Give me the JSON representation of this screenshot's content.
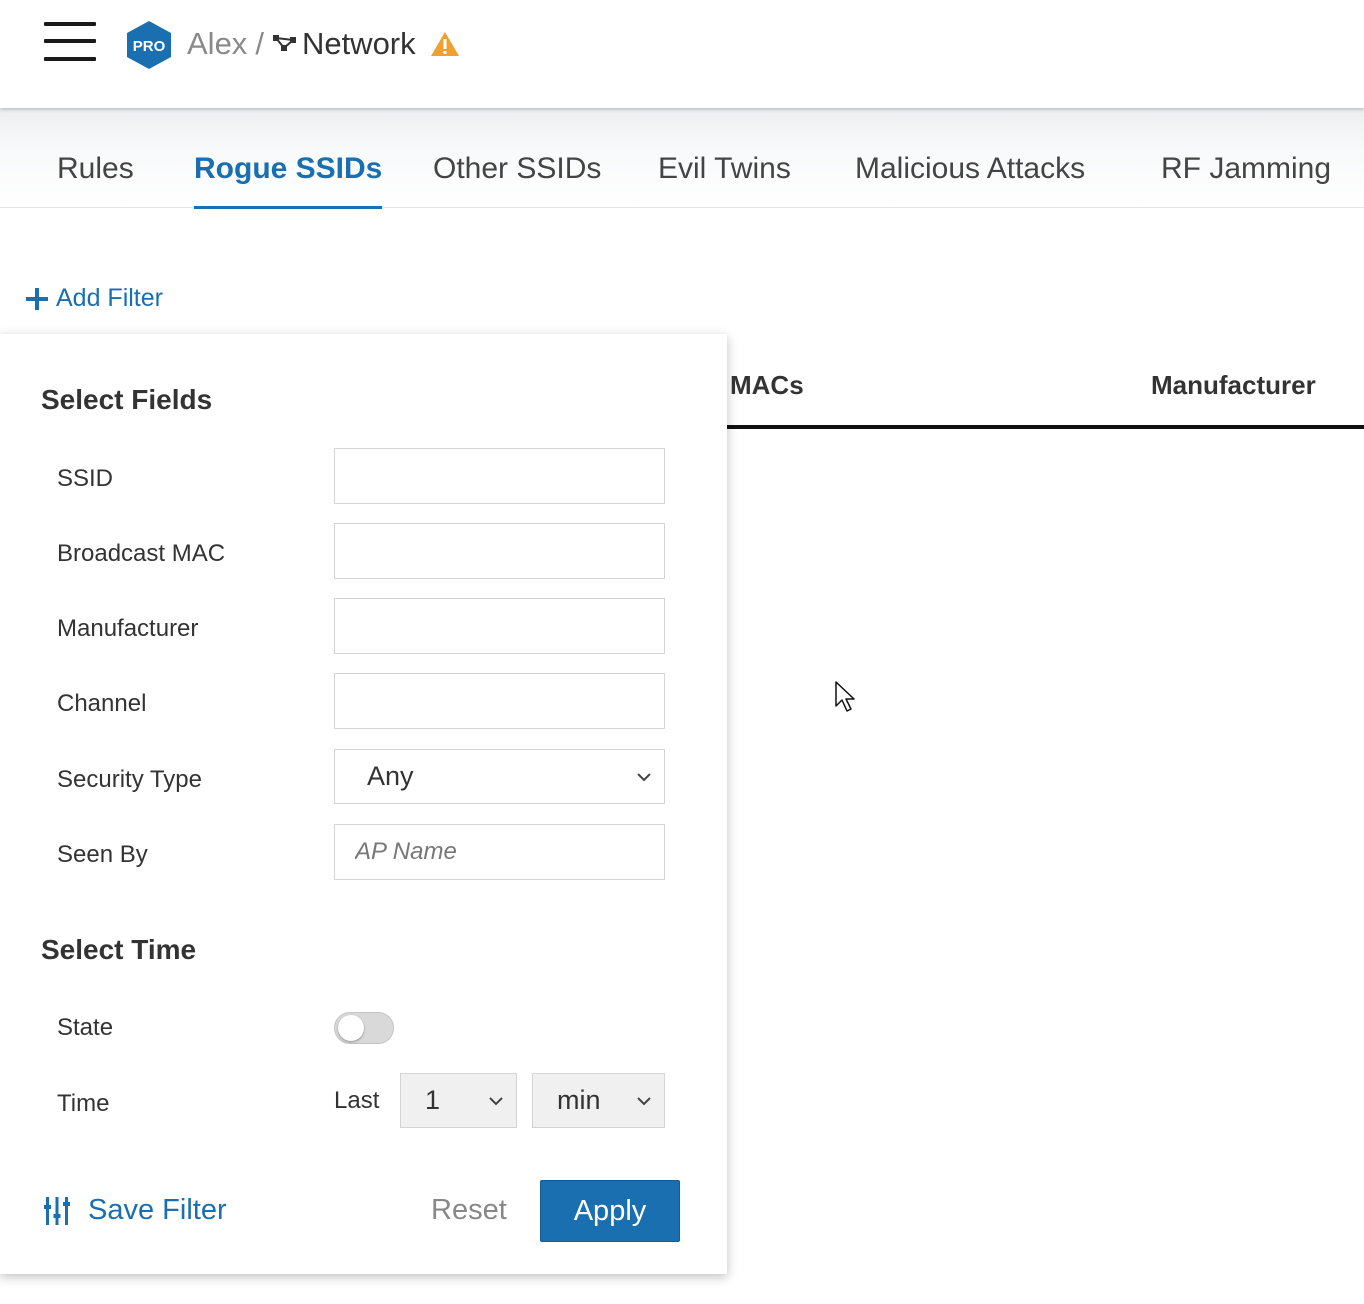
{
  "header": {
    "badge_text": "PRO",
    "breadcrumb_user": "Alex",
    "breadcrumb_separator": "/",
    "breadcrumb_network": "Network",
    "brand_color": "#1a6fb1",
    "warning_color": "#f0a030",
    "icons": [
      "menu-icon",
      "network-topology-icon",
      "warning-icon"
    ]
  },
  "tabs": [
    {
      "label": "Rules",
      "active": false
    },
    {
      "label": "Rogue SSIDs",
      "active": true
    },
    {
      "label": "Other SSIDs",
      "active": false
    },
    {
      "label": "Evil Twins",
      "active": false
    },
    {
      "label": "Malicious Attacks",
      "active": false
    },
    {
      "label": "RF Jamming",
      "active": false
    }
  ],
  "add_filter": {
    "label": "Add Filter",
    "icon": "plus-icon"
  },
  "table": {
    "columns": [
      "MACs",
      "Manufacturer"
    ]
  },
  "filter_panel": {
    "select_fields_title": "Select Fields",
    "fields": [
      {
        "label": "SSID",
        "value": "",
        "placeholder": ""
      },
      {
        "label": "Broadcast MAC",
        "value": "",
        "placeholder": ""
      },
      {
        "label": "Manufacturer",
        "value": "",
        "placeholder": ""
      },
      {
        "label": "Channel",
        "value": "",
        "placeholder": ""
      }
    ],
    "security_type": {
      "label": "Security Type",
      "selected": "Any"
    },
    "seen_by": {
      "label": "Seen By",
      "value": "",
      "placeholder": "AP Name"
    },
    "select_time_title": "Select Time",
    "state": {
      "label": "State",
      "enabled": false
    },
    "time": {
      "label": "Time",
      "prefix": "Last",
      "amount": "1",
      "unit": "min"
    },
    "save_filter_label": "Save Filter",
    "reset_label": "Reset",
    "apply_label": "Apply"
  }
}
